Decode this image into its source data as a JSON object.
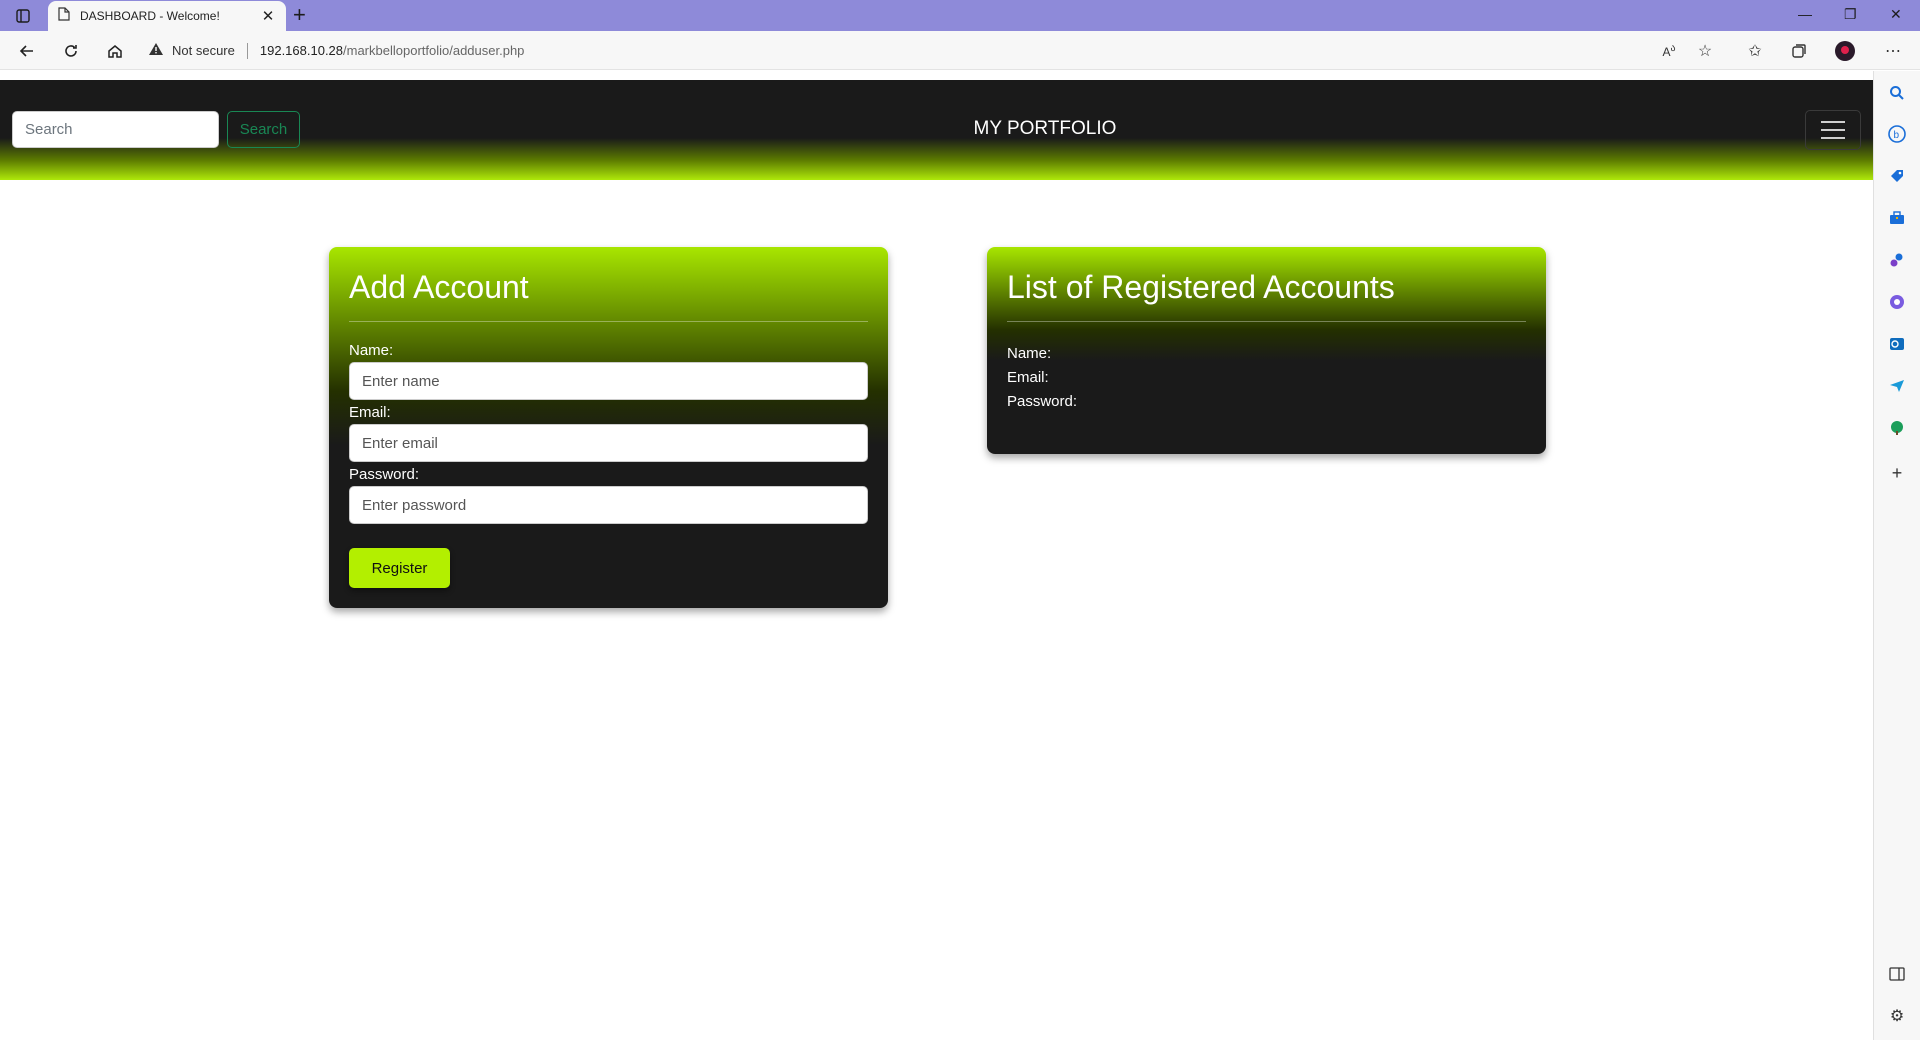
{
  "browser": {
    "tab_title": "DASHBOARD - Welcome!",
    "security_label": "Not secure",
    "url_host": "192.168.10.28",
    "url_path": "/markbelloportfolio/adduser.php"
  },
  "navbar": {
    "search_placeholder": "Search",
    "search_button": "Search",
    "brand": "MY PORTFOLIO"
  },
  "add_account": {
    "title": "Add Account",
    "name_label": "Name:",
    "name_placeholder": "Enter name",
    "email_label": "Email:",
    "email_placeholder": "Enter email",
    "password_label": "Password:",
    "password_placeholder": "Enter password",
    "register_button": "Register"
  },
  "accounts_list": {
    "title": "List of Registered Accounts",
    "name_label": "Name:",
    "email_label": "Email:",
    "password_label": "Password:"
  },
  "colors": {
    "accent": "#b3ef00",
    "navbar_dark": "#1a1a1a",
    "search_green": "#198754",
    "tabbar": "#8e8ad9"
  }
}
